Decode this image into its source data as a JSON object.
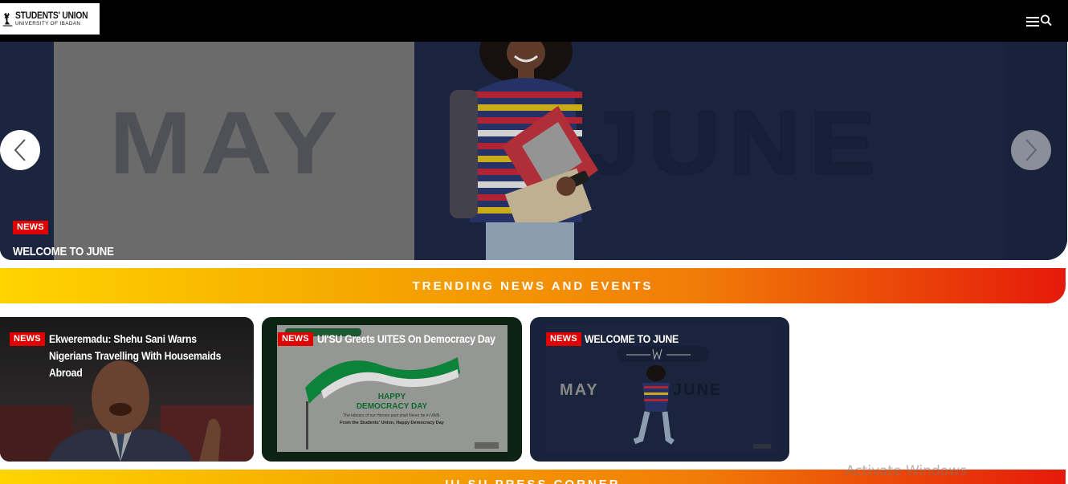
{
  "header": {
    "logo_main": "STUDENTS' UNION",
    "logo_sub": "UNIVERSITY OF IBADAN",
    "menu_icon": "menu-icon",
    "search_icon": "search-icon"
  },
  "hero": {
    "image_text_left": "MAY",
    "image_text_right": "JUNE",
    "badge": "NEWS",
    "title": "WELCOME TO JUNE",
    "prev_icon": "chevron-left-icon",
    "next_icon": "chevron-right-icon",
    "slide_count": 3,
    "active_slide": 3
  },
  "trending": {
    "title": "TRENDING NEWS AND EVENTS",
    "cards": [
      {
        "badge": "NEWS",
        "title": "Ekweremadu: Shehu Sani Warns Nigerians Travelling With Housemaids Abroad"
      },
      {
        "badge": "NEWS",
        "title": "UI'SU Greets UITES On Democracy Day",
        "image_heading": "HAPPY DEMOCRACY DAY",
        "image_line1": "The labours of our Heroes past shall Never be in VAIN",
        "image_line2": "From the Students' Union, Happy Democracy Day"
      },
      {
        "badge": "NEWS",
        "title": "WELCOME TO JUNE",
        "image_text_left": "MAY",
        "image_text_right": "JUNE"
      }
    ]
  },
  "bottom_section": {
    "title": "UI SU PRESS CORNER"
  },
  "overlay": {
    "watermark": "Activate Windows"
  },
  "colors": {
    "accent_red": "#e00000",
    "banner_start": "#ffd400",
    "banner_end": "#e51a0a",
    "header_bg": "#000000"
  }
}
